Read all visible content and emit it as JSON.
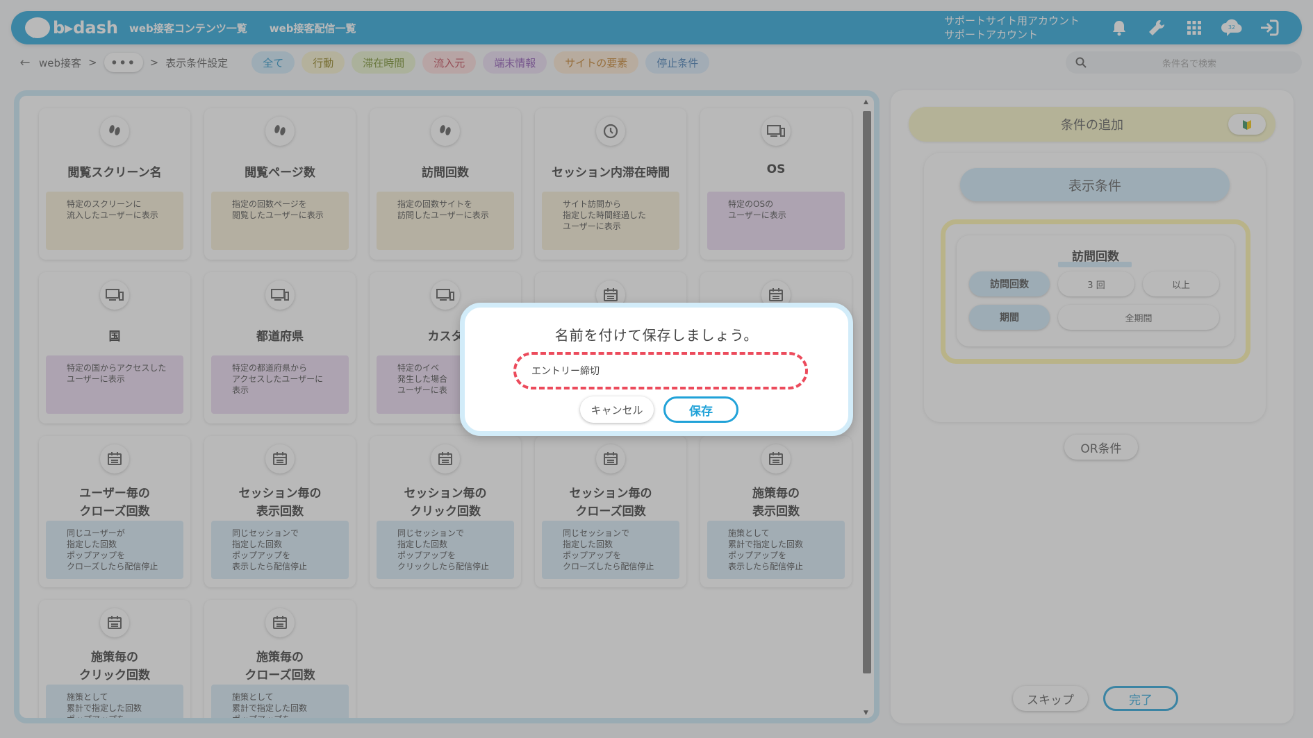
{
  "header": {
    "logo_text": "b▸dash",
    "nav": [
      "web接客コンテンツ一覧",
      "web接客配信一覧"
    ],
    "account_line1": "サポートサイト用アカウント",
    "account_line2": "サポートアカウント",
    "brand_color": "#21a2d8",
    "icons": [
      "bell-icon",
      "wrench-icon",
      "grid-menu-icon",
      "chat-cloud-icon",
      "logout-icon"
    ],
    "chat_badge": "32"
  },
  "subbar": {
    "back_icon": "arrow-left-icon",
    "crumb_root": "web接客",
    "crumb_sep": ">",
    "crumb_dots": "•••",
    "crumb_current": "表示条件設定",
    "chips": [
      {
        "label": "全て",
        "bg": "#cde8f8",
        "color": "#1f8fc4"
      },
      {
        "label": "行動",
        "bg": "#f6f1cc",
        "color": "#8a7a10"
      },
      {
        "label": "滞在時間",
        "bg": "#e6f1c9",
        "color": "#6f8a20"
      },
      {
        "label": "流入元",
        "bg": "#fbdada",
        "color": "#c04050"
      },
      {
        "label": "端末情報",
        "bg": "#e9dcf3",
        "color": "#8a4fb0"
      },
      {
        "label": "サイトの要素",
        "bg": "#fbe6cf",
        "color": "#c07a20"
      },
      {
        "label": "停止条件",
        "bg": "#d6e8f8",
        "color": "#3a75b0"
      }
    ],
    "search_placeholder": "条件名で検索"
  },
  "cards": [
    {
      "title": "閲覧スクリーン名",
      "desc": "特定のスクリーンに\n流入したユーザーに表示",
      "icon": "footprints-icon",
      "tone": "yellow"
    },
    {
      "title": "閲覧ページ数",
      "desc": "指定の回数ページを\n閲覧したユーザーに表示",
      "icon": "footprints-icon",
      "tone": "yellow"
    },
    {
      "title": "訪問回数",
      "desc": "指定の回数サイトを\n訪問したユーザーに表示",
      "icon": "footprints-icon",
      "tone": "yellow"
    },
    {
      "title": "セッション内滞在時間",
      "desc": "サイト訪問から\n指定した時間経過した\nユーザーに表示",
      "icon": "clock-icon",
      "tone": "green"
    },
    {
      "title": "OS",
      "desc": "特定のOSの\nユーザーに表示",
      "icon": "devices-icon",
      "tone": "purple"
    },
    {
      "title": "国",
      "desc": "特定の国からアクセスした\nユーザーに表示",
      "icon": "devices-icon",
      "tone": "purple"
    },
    {
      "title": "都道府県",
      "desc": "特定の都道府県から\nアクセスしたユーザーに\n表示",
      "icon": "devices-icon",
      "tone": "purple"
    },
    {
      "title": "カスタ",
      "desc": "特定のイベ\n発生した場合\nユーザーに表",
      "icon": "devices-icon",
      "tone": "purple"
    },
    {
      "title": "",
      "desc": "",
      "icon": "calendar-icon",
      "tone": "blue"
    },
    {
      "title": "",
      "desc": "",
      "icon": "calendar-icon",
      "tone": "blue"
    },
    {
      "title": "ユーザー毎の\nクローズ回数",
      "desc": "同じユーザーが\n指定した回数\nポップアップを\nクローズしたら配信停止",
      "icon": "calendar-icon",
      "tone": "blue"
    },
    {
      "title": "セッション毎の\n表示回数",
      "desc": "同じセッションで\n指定した回数\nポップアップを\n表示したら配信停止",
      "icon": "calendar-icon",
      "tone": "blue"
    },
    {
      "title": "セッション毎の\nクリック回数",
      "desc": "同じセッションで\n指定した回数\nポップアップを\nクリックしたら配信停止",
      "icon": "calendar-icon",
      "tone": "blue"
    },
    {
      "title": "セッション毎の\nクローズ回数",
      "desc": "同じセッションで\n指定した回数\nポップアップを\nクローズしたら配信停止",
      "icon": "calendar-icon",
      "tone": "blue"
    },
    {
      "title": "施策毎の\n表示回数",
      "desc": "施策として\n累計で指定した回数\nポップアップを\n表示したら配信停止",
      "icon": "calendar-icon",
      "tone": "blue"
    },
    {
      "title": "施策毎の\nクリック回数",
      "desc": "施策として\n累計で指定した回数\nポップアップを",
      "icon": "calendar-icon",
      "tone": "blue"
    },
    {
      "title": "施策毎の\nクローズ回数",
      "desc": "施策として\n累計で指定した回数\nポップアップを",
      "icon": "calendar-icon",
      "tone": "blue"
    }
  ],
  "right": {
    "add_label": "条件の追加",
    "beginner_icon": "beginner-mark-icon",
    "cond_title": "表示条件",
    "visit_title": "訪問回数",
    "row1": {
      "label": "訪問回数",
      "value": "3 回",
      "op": "以上"
    },
    "row2": {
      "label": "期間",
      "value": "全期間"
    },
    "or_label": "OR条件",
    "skip_label": "スキップ",
    "done_label": "完了"
  },
  "modal": {
    "title": "名前を付けて保存しましょう。",
    "input_value": "エントリー締切",
    "cancel_label": "キャンセル",
    "save_label": "保存"
  }
}
